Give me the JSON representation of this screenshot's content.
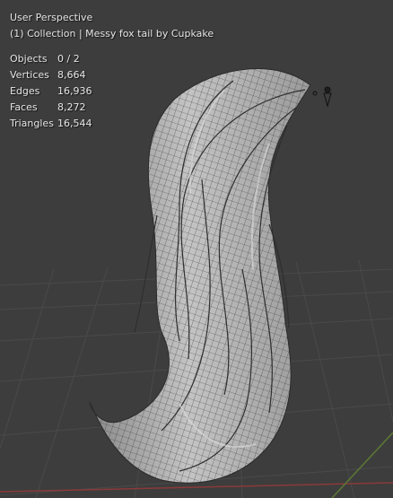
{
  "viewport": {
    "view_name": "User Perspective",
    "collection_line": "(1) Collection | Messy fox tail by Cupkake"
  },
  "stats": [
    {
      "label": "Objects",
      "value": "0 / 2"
    },
    {
      "label": "Vertices",
      "value": "8,664"
    },
    {
      "label": "Edges",
      "value": "16,936"
    },
    {
      "label": "Faces",
      "value": "8,272"
    },
    {
      "label": "Triangles",
      "value": "16,544"
    }
  ],
  "colors": {
    "background": "#3d3d3d",
    "grid_line": "#4a4a4a",
    "axis_red": "#8a3a3a",
    "axis_green": "#5c7a34",
    "mesh_fill": "#b9b9b9",
    "mesh_shadow": "#7e7e7e",
    "wire": "#2a2a2a"
  },
  "icons": [
    "light-icon"
  ]
}
